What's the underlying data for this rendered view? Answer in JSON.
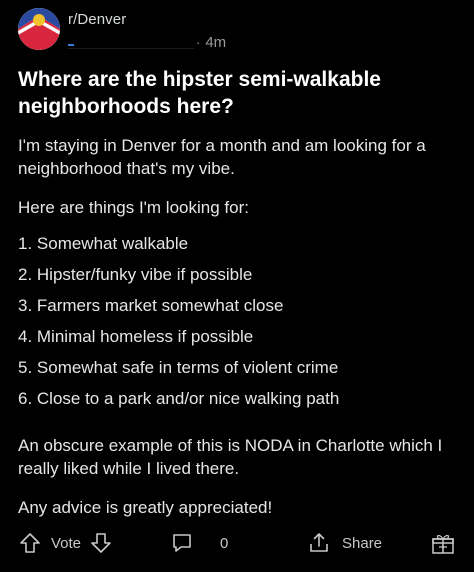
{
  "post": {
    "subreddit": "r/Denver",
    "dot": "·",
    "age": "4m",
    "title": "Where are the hipster semi-walkable neighborhoods here?",
    "paragraphs": {
      "intro": "I'm staying in Denver for a month and am looking for a neighborhood that's my vibe.",
      "list_intro": "Here are things I'm looking for:",
      "example": "An obscure example of this is NODA in Charlotte which I really liked while I lived there.",
      "closing": "Any advice is greatly appreciated!"
    },
    "list": [
      "1. Somewhat walkable",
      "2. Hipster/funky vibe if possible",
      "3. Farmers market somewhat close",
      "4. Minimal homeless if possible",
      "5. Somewhat safe in terms of violent crime",
      "6. Close to a park and/or nice walking path"
    ]
  },
  "actions": {
    "vote_label": "Vote",
    "comment_count": "0",
    "share_label": "Share"
  },
  "icons": {
    "avatar": "denver-flag-logo",
    "upvote": "arrow-up-icon",
    "downvote": "arrow-down-icon",
    "comment": "speech-bubble-icon",
    "share": "share-icon",
    "award": "gift-award-icon"
  },
  "colors": {
    "background": "#000000",
    "text": "#e6e6e6",
    "muted": "#9a9a9a",
    "flag_blue": "#2a4aa0",
    "flag_red": "#d7263d",
    "flag_yellow": "#f2c12e"
  }
}
